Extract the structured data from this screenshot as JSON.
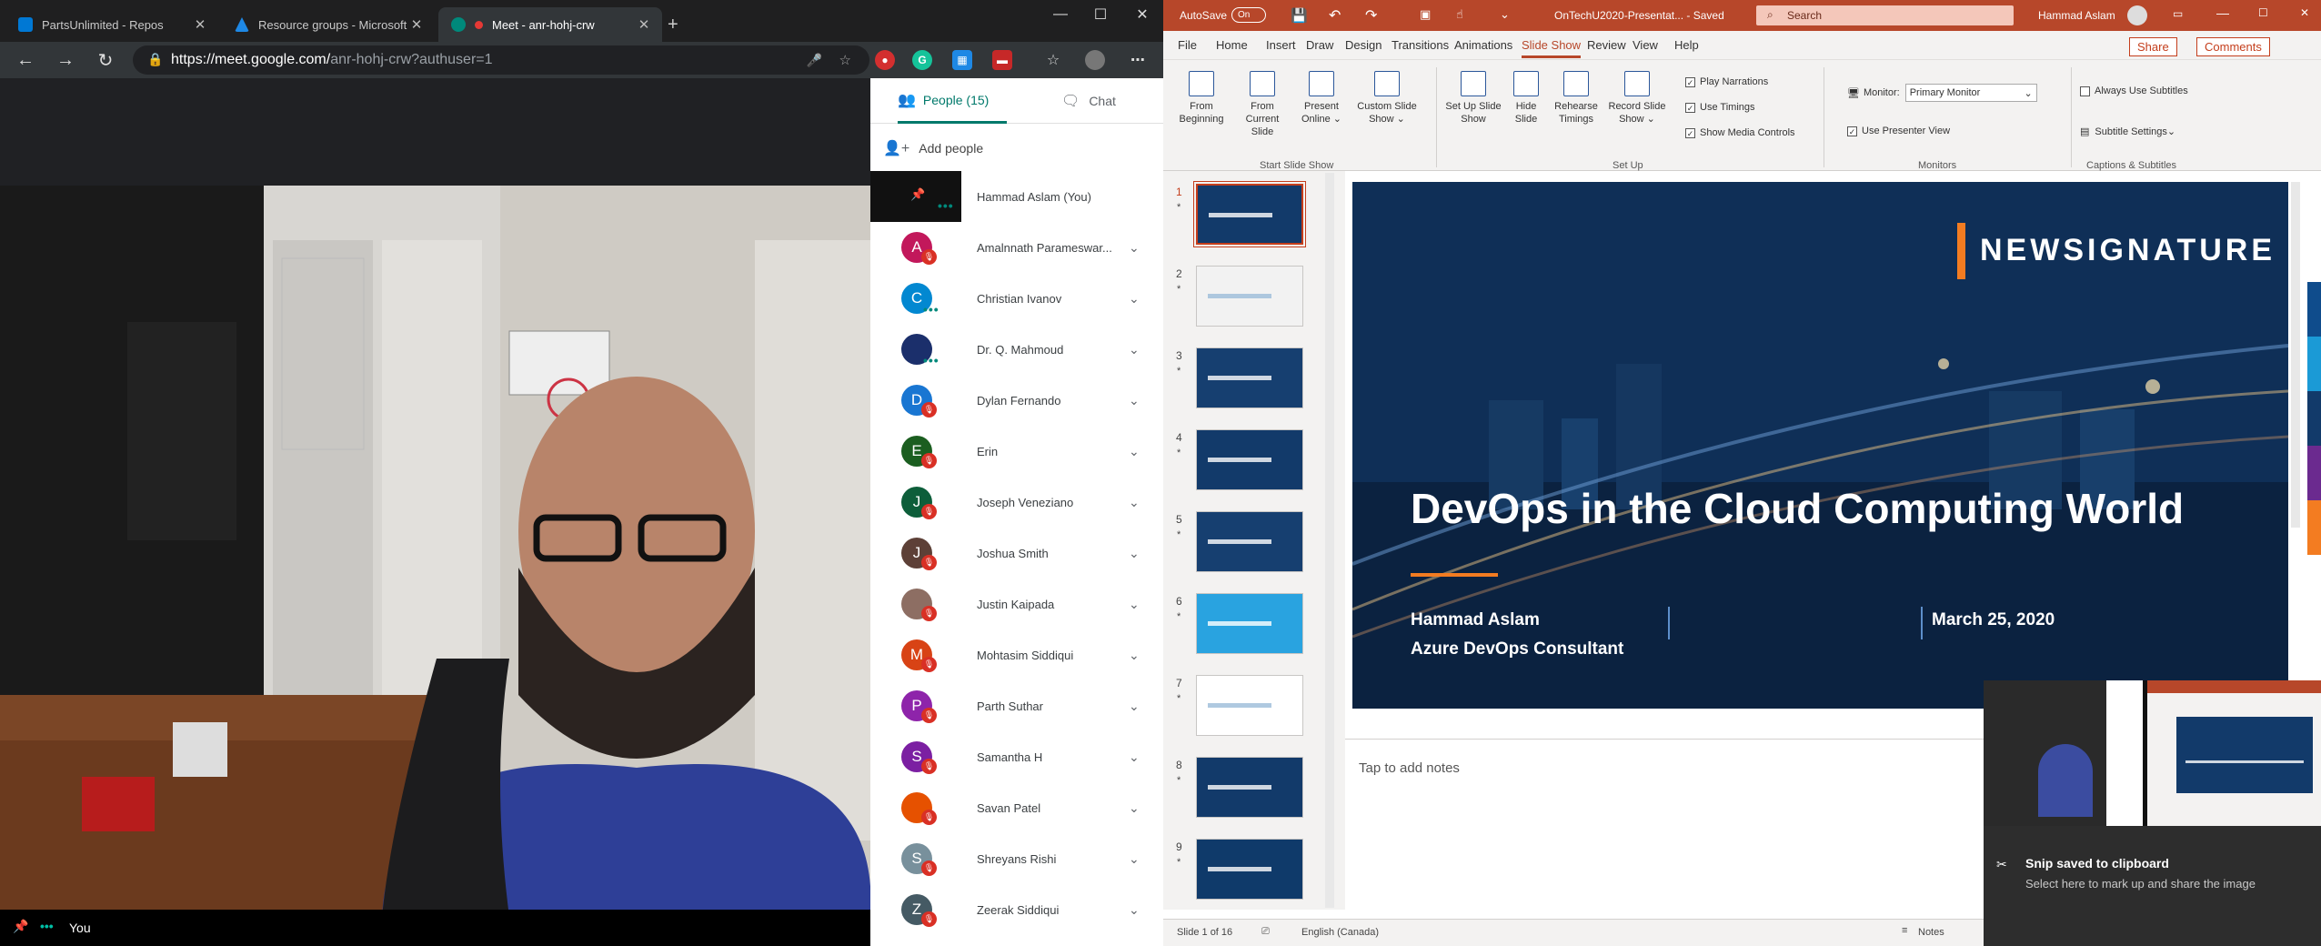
{
  "browser": {
    "tabs": [
      {
        "label": "PartsUnlimited - Repos",
        "color": "#0078d4"
      },
      {
        "label": "Resource groups - Microsoft Azure",
        "color": "#1e88e5"
      },
      {
        "label": "Meet - anr-hohj-crw",
        "color": "#00897b",
        "active": true
      }
    ],
    "new_tab": "+",
    "url_main": "https://meet.google.com/",
    "url_path": "anr-hohj-crw?authuser=1"
  },
  "meet": {
    "you_label": "You",
    "tabs": {
      "people": "People (15)",
      "chat": "Chat"
    },
    "add_people": "Add people",
    "participants": [
      {
        "name": "Hammad Aslam (You)",
        "initial": "",
        "color": "#1a1a1a",
        "state": "self"
      },
      {
        "name": "Amalnnath Parameswar...",
        "initial": "A",
        "color": "#c2185b",
        "state": "muted"
      },
      {
        "name": "Christian Ivanov",
        "initial": "C",
        "color": "#0288d1",
        "state": "talking"
      },
      {
        "name": "Dr. Q. Mahmoud",
        "initial": "",
        "color": "#1b2f6b",
        "state": "talking"
      },
      {
        "name": "Dylan Fernando",
        "initial": "D",
        "color": "#1976d2",
        "state": "muted"
      },
      {
        "name": "Erin",
        "initial": "E",
        "color": "#1b5e20",
        "state": "muted"
      },
      {
        "name": "Joseph Veneziano",
        "initial": "J",
        "color": "#0d5e3a",
        "state": "muted"
      },
      {
        "name": "Joshua Smith",
        "initial": "J",
        "color": "#5d4037",
        "state": "muted"
      },
      {
        "name": "Justin Kaipada",
        "initial": "",
        "color": "#8d6e63",
        "state": "muted"
      },
      {
        "name": "Mohtasim Siddiqui",
        "initial": "M",
        "color": "#d84315",
        "state": "muted"
      },
      {
        "name": "Parth Suthar",
        "initial": "P",
        "color": "#8e24aa",
        "state": "muted"
      },
      {
        "name": "Samantha H",
        "initial": "S",
        "color": "#7b1fa2",
        "state": "muted"
      },
      {
        "name": "Savan Patel",
        "initial": "",
        "color": "#e65100",
        "state": "muted"
      },
      {
        "name": "Shreyans Rishi",
        "initial": "S",
        "color": "#78909c",
        "state": "muted"
      },
      {
        "name": "Zeerak Siddiqui",
        "initial": "Z",
        "color": "#455a64",
        "state": "muted"
      }
    ]
  },
  "ppt": {
    "autosave_label": "AutoSave",
    "autosave_state": "On",
    "file_title": "OnTechU2020-Presentat... - Saved",
    "search_placeholder": "Search",
    "user_name": "Hammad Aslam",
    "menu": [
      "File",
      "Home",
      "Insert",
      "Draw",
      "Design",
      "Transitions",
      "Animations",
      "Slide Show",
      "Review",
      "View",
      "Help"
    ],
    "active_menu": "Slide Show",
    "share_label": "Share",
    "comments_label": "Comments",
    "ribbon": {
      "from_beginning": "From Beginning",
      "from_current": "From Current Slide",
      "present_online": "Present Online",
      "custom_show": "Custom Slide Show",
      "group_start": "Start Slide Show",
      "setup_show": "Set Up Slide Show",
      "hide_slide": "Hide Slide",
      "rehearse": "Rehearse Timings",
      "record": "Record Slide Show",
      "play_narrations": "Play Narrations",
      "use_timings": "Use Timings",
      "show_media": "Show Media Controls",
      "group_setup": "Set Up",
      "monitor_label": "Monitor:",
      "monitor_value": "Primary Monitor",
      "presenter_view": "Use Presenter View",
      "group_monitors": "Monitors",
      "always_subtitles": "Always Use Subtitles",
      "subtitle_settings": "Subtitle Settings",
      "group_captions": "Captions & Subtitles"
    },
    "slide_numbers": [
      "1",
      "2",
      "3",
      "4",
      "5",
      "6",
      "7",
      "8",
      "9"
    ],
    "slide": {
      "brand": "NEWSIGNATURE",
      "title": "DevOps in the Cloud Computing World",
      "presenter": "Hammad Aslam",
      "role": "Azure DevOps Consultant",
      "date": "March 25, 2020"
    },
    "notes_placeholder": "Tap to add notes",
    "status": {
      "slide_of": "Slide 1 of 16",
      "language": "English (Canada)",
      "notes": "Notes"
    }
  },
  "snip": {
    "title": "Snip saved to clipboard",
    "body": "Select here to mark up and share the image"
  }
}
